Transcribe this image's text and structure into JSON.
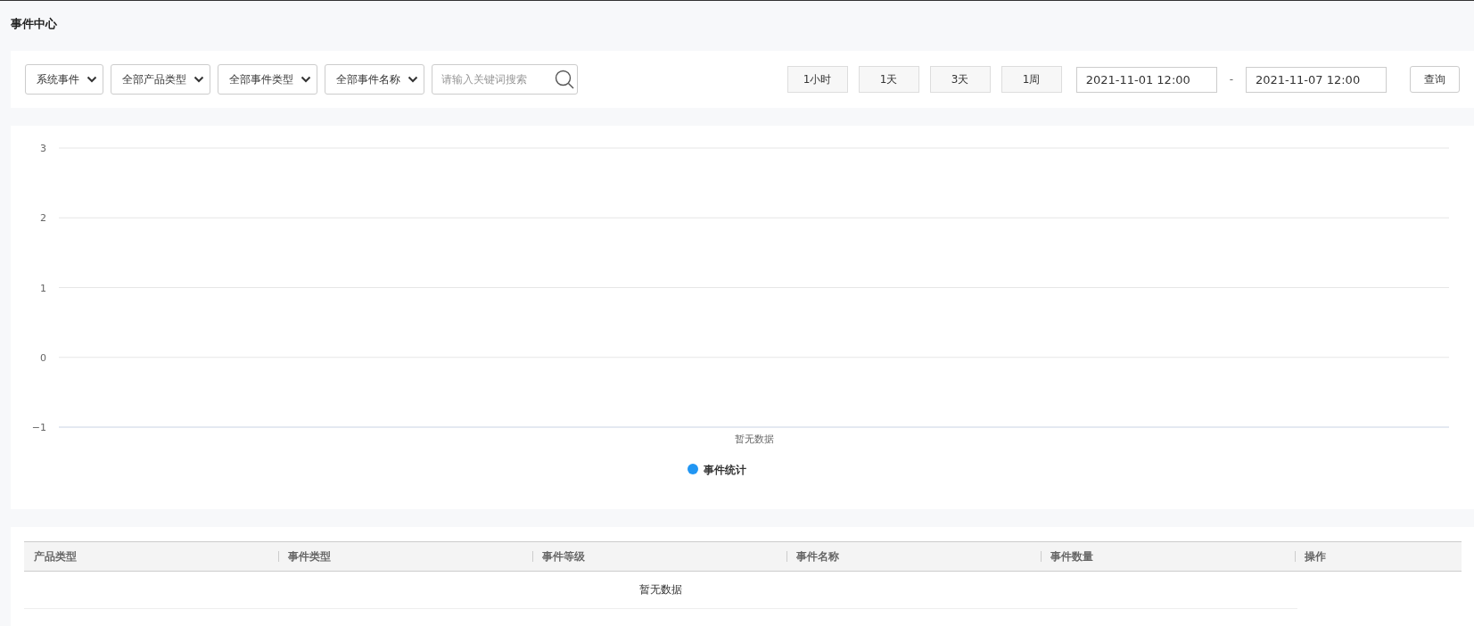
{
  "page_title": "事件中心",
  "filters": {
    "selects": [
      {
        "value": "系统事件"
      },
      {
        "value": "全部产品类型"
      },
      {
        "value": "全部事件类型"
      },
      {
        "value": "全部事件名称"
      }
    ],
    "search": {
      "placeholder": "请输入关键词搜索"
    },
    "ranges": [
      {
        "label": "1小时",
        "selected": false
      },
      {
        "label": "1天",
        "selected": false
      },
      {
        "label": "3天",
        "selected": false
      },
      {
        "label": "1周",
        "selected": false
      }
    ],
    "start": "2021-11-01 12:00",
    "separator": "-",
    "end": "2021-11-07 12:00",
    "query_button": "查询"
  },
  "chart": {
    "chart_data": {
      "type": "line",
      "grid": true,
      "categories": [
        "暂无数据"
      ],
      "ylim": [
        -1,
        3
      ],
      "yticks": [
        -1,
        0,
        1,
        2,
        3
      ],
      "series": [
        {
          "name": "事件统计",
          "color": "#2196f3",
          "values": [
            null
          ]
        }
      ]
    }
  },
  "table": {
    "columns": [
      "产品类型",
      "事件类型",
      "事件等级",
      "事件名称",
      "事件数量",
      "操作"
    ],
    "empty_text": "暂无数据"
  }
}
